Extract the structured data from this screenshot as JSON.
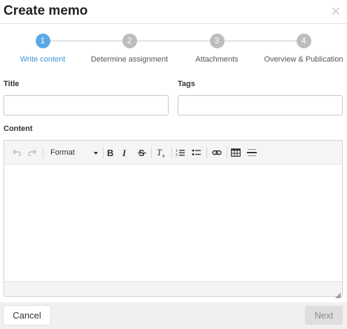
{
  "dialog": {
    "title": "Create memo"
  },
  "stepper": {
    "steps": [
      {
        "number": "1",
        "label": "Write content",
        "active": true
      },
      {
        "number": "2",
        "label": "Determine assignment",
        "active": false
      },
      {
        "number": "3",
        "label": "Attachments",
        "active": false
      },
      {
        "number": "4",
        "label": "Overview & Publication",
        "active": false
      }
    ],
    "active_color": "#5aa9e6",
    "inactive_color": "#bdbdbd"
  },
  "form": {
    "title_label": "Title",
    "title_value": "",
    "tags_label": "Tags",
    "tags_value": "",
    "content_label": "Content"
  },
  "editor": {
    "format_label": "Format",
    "toolbar_icons": [
      "undo-icon",
      "redo-icon",
      "bold-icon",
      "italic-icon",
      "strikethrough-icon",
      "remove-format-icon",
      "numbered-list-icon",
      "bulleted-list-icon",
      "link-icon",
      "table-icon",
      "horizontal-line-icon"
    ]
  },
  "footer": {
    "cancel_label": "Cancel",
    "next_label": "Next"
  }
}
